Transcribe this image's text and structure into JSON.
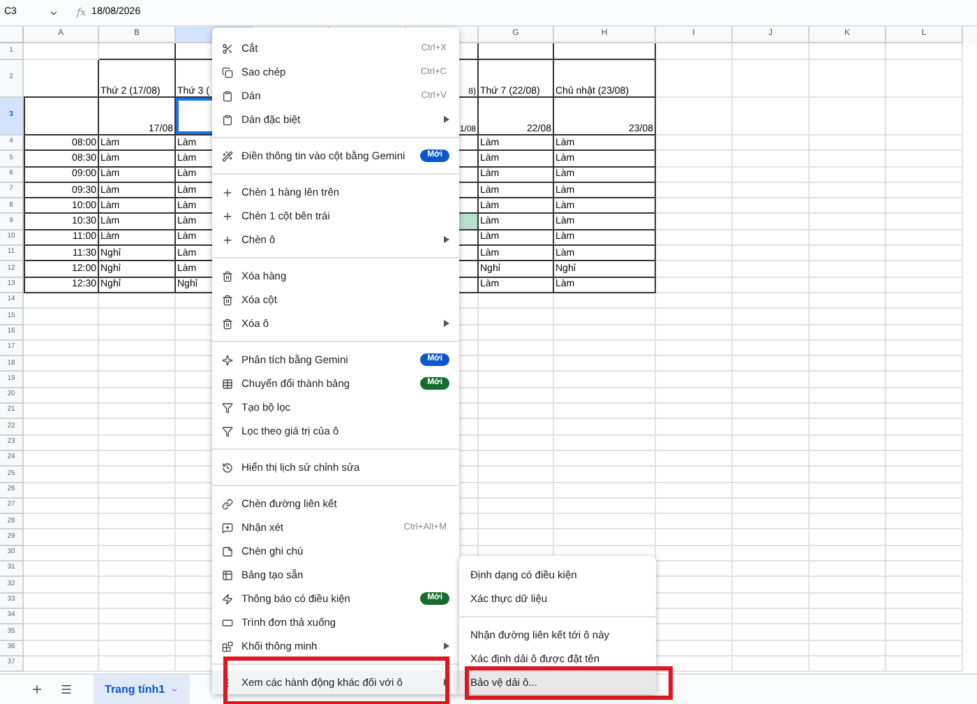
{
  "formula_bar": {
    "cell_ref": "C3",
    "function_label": "fx",
    "formula": "18/08/2026"
  },
  "columns": [
    {
      "label": "A",
      "selected": false
    },
    {
      "label": "B",
      "selected": false
    },
    {
      "selected": true
    },
    {
      "selected": false
    },
    {
      "selected": false
    },
    {
      "selected": false
    },
    {
      "label": "G",
      "selected": false
    },
    {
      "label": "H",
      "selected": false
    },
    {
      "label": "I",
      "selected": false
    },
    {
      "label": "J",
      "selected": false
    },
    {
      "label": "K",
      "selected": false
    },
    {
      "label": "L",
      "selected": false
    }
  ],
  "rows": [
    {
      "number": "1",
      "selected": false,
      "kind": "blank"
    },
    {
      "number": "2",
      "selected": false,
      "kind": "header",
      "cells": [
        null,
        {
          "text": "Thứ 2 (17/08)"
        },
        {
          "text": "Thứ 3 ("
        },
        null,
        null,
        {
          "text": "8)"
        },
        {
          "text": "Thứ 7 (22/08)"
        },
        {
          "text": "Chủ nhật (23/08)"
        }
      ]
    },
    {
      "number": "3",
      "selected": true,
      "kind": "dates",
      "cells": [
        null,
        {
          "text": "17/08"
        },
        null,
        null,
        null,
        {
          "text": "1/08"
        },
        {
          "text": "22/08"
        },
        {
          "text": "23/08"
        }
      ]
    },
    {
      "number": "4",
      "selected": false,
      "kind": "data",
      "cells": [
        {
          "text": "08:00"
        },
        {
          "text": "Làm"
        },
        {
          "text": "Làm"
        },
        null,
        null,
        null,
        {
          "text": "Làm"
        },
        {
          "text": "Làm"
        }
      ]
    },
    {
      "number": "5",
      "selected": false,
      "kind": "data",
      "cells": [
        {
          "text": "08:30"
        },
        {
          "text": "Làm"
        },
        {
          "text": "Làm"
        },
        null,
        null,
        null,
        {
          "text": "Làm"
        },
        {
          "text": "Làm"
        }
      ]
    },
    {
      "number": "6",
      "selected": false,
      "kind": "data",
      "cells": [
        {
          "text": "09:00"
        },
        {
          "text": "Làm"
        },
        {
          "text": "Làm"
        },
        null,
        null,
        null,
        {
          "text": "Làm"
        },
        {
          "text": "Làm"
        }
      ]
    },
    {
      "number": "7",
      "selected": false,
      "kind": "data",
      "cells": [
        {
          "text": "09:30"
        },
        {
          "text": "Làm"
        },
        {
          "text": "Làm"
        },
        null,
        null,
        null,
        {
          "text": "Làm"
        },
        {
          "text": "Làm"
        }
      ]
    },
    {
      "number": "8",
      "selected": false,
      "kind": "data",
      "cells": [
        {
          "text": "10:00"
        },
        {
          "text": "Làm"
        },
        {
          "text": "Làm"
        },
        null,
        null,
        null,
        {
          "text": "Làm"
        },
        {
          "text": "Làm"
        }
      ]
    },
    {
      "number": "9",
      "selected": false,
      "kind": "data",
      "cells": [
        {
          "text": "10:30"
        },
        {
          "text": "Làm"
        },
        {
          "text": "Làm"
        },
        null,
        null,
        {
          "color": "#b7e1cd"
        },
        {
          "text": "Làm"
        },
        {
          "text": "Làm"
        }
      ]
    },
    {
      "number": "10",
      "selected": false,
      "kind": "data",
      "cells": [
        {
          "text": "11:00"
        },
        {
          "text": "Làm"
        },
        {
          "text": "Làm"
        },
        null,
        null,
        null,
        {
          "text": "Làm"
        },
        {
          "text": "Làm"
        }
      ]
    },
    {
      "number": "11",
      "selected": false,
      "kind": "data",
      "cells": [
        {
          "text": "11:30"
        },
        {
          "text": "Nghỉ"
        },
        {
          "text": "Làm"
        },
        null,
        null,
        null,
        {
          "text": "Làm"
        },
        {
          "text": "Làm"
        }
      ]
    },
    {
      "number": "12",
      "selected": false,
      "kind": "data",
      "cells": [
        {
          "text": "12:00"
        },
        {
          "text": "Nghỉ"
        },
        {
          "text": "Làm"
        },
        null,
        null,
        null,
        {
          "text": "Nghỉ"
        },
        {
          "text": "Nghỉ"
        }
      ]
    },
    {
      "number": "13",
      "selected": false,
      "kind": "data",
      "cells": [
        {
          "text": "12:30"
        },
        {
          "text": "Nghỉ"
        },
        {
          "text": "Nghỉ"
        },
        null,
        null,
        null,
        {
          "text": "Làm"
        },
        {
          "text": "Làm"
        }
      ]
    },
    {
      "number": "14",
      "selected": false,
      "kind": "blank"
    },
    {
      "number": "15",
      "selected": false,
      "kind": "blank"
    },
    {
      "number": "16",
      "selected": false,
      "kind": "blank"
    },
    {
      "number": "17",
      "selected": false,
      "kind": "blank"
    },
    {
      "number": "18",
      "selected": false,
      "kind": "blank"
    },
    {
      "number": "19",
      "selected": false,
      "kind": "blank"
    },
    {
      "number": "20",
      "selected": false,
      "kind": "blank"
    },
    {
      "number": "21",
      "selected": false,
      "kind": "blank"
    },
    {
      "number": "22",
      "selected": false,
      "kind": "blank"
    },
    {
      "number": "23",
      "selected": false,
      "kind": "blank"
    },
    {
      "number": "24",
      "selected": false,
      "kind": "blank"
    },
    {
      "number": "25",
      "selected": false,
      "kind": "blank"
    },
    {
      "number": "26",
      "selected": false,
      "kind": "blank"
    },
    {
      "number": "27",
      "selected": false,
      "kind": "blank"
    },
    {
      "number": "28",
      "selected": false,
      "kind": "blank"
    },
    {
      "number": "29",
      "selected": false,
      "kind": "blank"
    },
    {
      "number": "30",
      "selected": false,
      "kind": "blank"
    },
    {
      "number": "31",
      "selected": false,
      "kind": "blank"
    },
    {
      "number": "32",
      "selected": false,
      "kind": "blank"
    },
    {
      "number": "33",
      "selected": false,
      "kind": "blank"
    },
    {
      "number": "34",
      "selected": false,
      "kind": "blank"
    },
    {
      "number": "35",
      "selected": false,
      "kind": "blank"
    },
    {
      "number": "36",
      "selected": false,
      "kind": "blank"
    },
    {
      "number": "37",
      "selected": false,
      "kind": "blank"
    }
  ],
  "context_menu": [
    {
      "kind": "item",
      "label": "Cắt",
      "shortcut": "Ctrl+X",
      "has_submenu": false,
      "highlighted": false
    },
    {
      "kind": "item",
      "label": "Sao chép",
      "shortcut": "Ctrl+C",
      "has_submenu": false,
      "highlighted": false
    },
    {
      "kind": "item",
      "label": "Dán",
      "shortcut": "Ctrl+V",
      "has_submenu": false,
      "highlighted": false
    },
    {
      "kind": "item",
      "label": "Dán đặc biệt",
      "has_submenu": true,
      "highlighted": false
    },
    {
      "kind": "divider"
    },
    {
      "kind": "item",
      "label": "Điền thông tin vào cột bằng Gemini",
      "badge": {
        "text": "Mới",
        "color": "#0b57d0"
      },
      "has_submenu": false,
      "highlighted": false
    },
    {
      "kind": "divider"
    },
    {
      "kind": "item",
      "label": "Chèn 1 hàng lên trên",
      "has_submenu": false,
      "highlighted": false
    },
    {
      "kind": "item",
      "label": "Chèn 1 cột bên trái",
      "has_submenu": false,
      "highlighted": false
    },
    {
      "kind": "item",
      "label": "Chèn ô",
      "has_submenu": true,
      "highlighted": false
    },
    {
      "kind": "divider"
    },
    {
      "kind": "item",
      "label": "Xóa hàng",
      "has_submenu": false,
      "highlighted": false
    },
    {
      "kind": "item",
      "label": "Xóa cột",
      "has_submenu": false,
      "highlighted": false
    },
    {
      "kind": "item",
      "label": "Xóa ô",
      "has_submenu": true,
      "highlighted": false
    },
    {
      "kind": "divider"
    },
    {
      "kind": "item",
      "label": "Phân tích bằng Gemini",
      "badge": {
        "text": "Mới",
        "color": "#0b57d0"
      },
      "has_submenu": false,
      "highlighted": false
    },
    {
      "kind": "item",
      "label": "Chuyển đổi thành bảng",
      "badge": {
        "text": "Mới",
        "color": "#146c2e"
      },
      "has_submenu": false,
      "highlighted": false
    },
    {
      "kind": "item",
      "label": "Tạo bộ lọc",
      "has_submenu": false,
      "highlighted": false
    },
    {
      "kind": "item",
      "label": "Lọc theo giá trị của ô",
      "has_submenu": false,
      "highlighted": false
    },
    {
      "kind": "divider"
    },
    {
      "kind": "item",
      "label": "Hiển thị lịch sử chỉnh sửa",
      "has_submenu": false,
      "highlighted": false
    },
    {
      "kind": "divider"
    },
    {
      "kind": "item",
      "label": "Chèn đường liên kết",
      "has_submenu": false,
      "highlighted": false
    },
    {
      "kind": "item",
      "label": "Nhận xét",
      "shortcut": "Ctrl+Alt+M",
      "has_submenu": false,
      "highlighted": false
    },
    {
      "kind": "item",
      "label": "Chèn ghi chú",
      "has_submenu": false,
      "highlighted": false
    },
    {
      "kind": "item",
      "label": "Bảng tạo sẵn",
      "has_submenu": false,
      "highlighted": false
    },
    {
      "kind": "item",
      "label": "Thông báo có điều kiện",
      "badge": {
        "text": "Mới",
        "color": "#146c2e"
      },
      "has_submenu": false,
      "highlighted": false
    },
    {
      "kind": "item",
      "label": "Trình đơn thả xuống",
      "has_submenu": false,
      "highlighted": false
    },
    {
      "kind": "item",
      "label": "Khối thông minh",
      "has_submenu": true,
      "highlighted": false
    },
    {
      "kind": "divider"
    },
    {
      "kind": "item",
      "label": "Xem các hành động khác đối với ô",
      "has_submenu": true,
      "highlighted": true,
      "submenu_items": [
        {
          "kind": "item",
          "label": "Định dạng có điều kiện",
          "highlighted": false,
          "selected": false
        },
        {
          "kind": "item",
          "label": "Xác thực dữ liệu",
          "highlighted": false,
          "selected": false
        },
        {
          "kind": "divider"
        },
        {
          "kind": "item",
          "label": "Nhận đường liên kết tới ô này",
          "highlighted": false,
          "selected": false
        },
        {
          "kind": "item",
          "label": "Xác định dải ô được đặt tên",
          "highlighted": false,
          "selected": false
        },
        {
          "kind": "item",
          "label": "Bảo vệ dải ô...",
          "highlighted": true,
          "selected": true
        }
      ]
    }
  ],
  "sheet_tabs": [
    {
      "label": "Trang tính1",
      "selected": true
    }
  ]
}
